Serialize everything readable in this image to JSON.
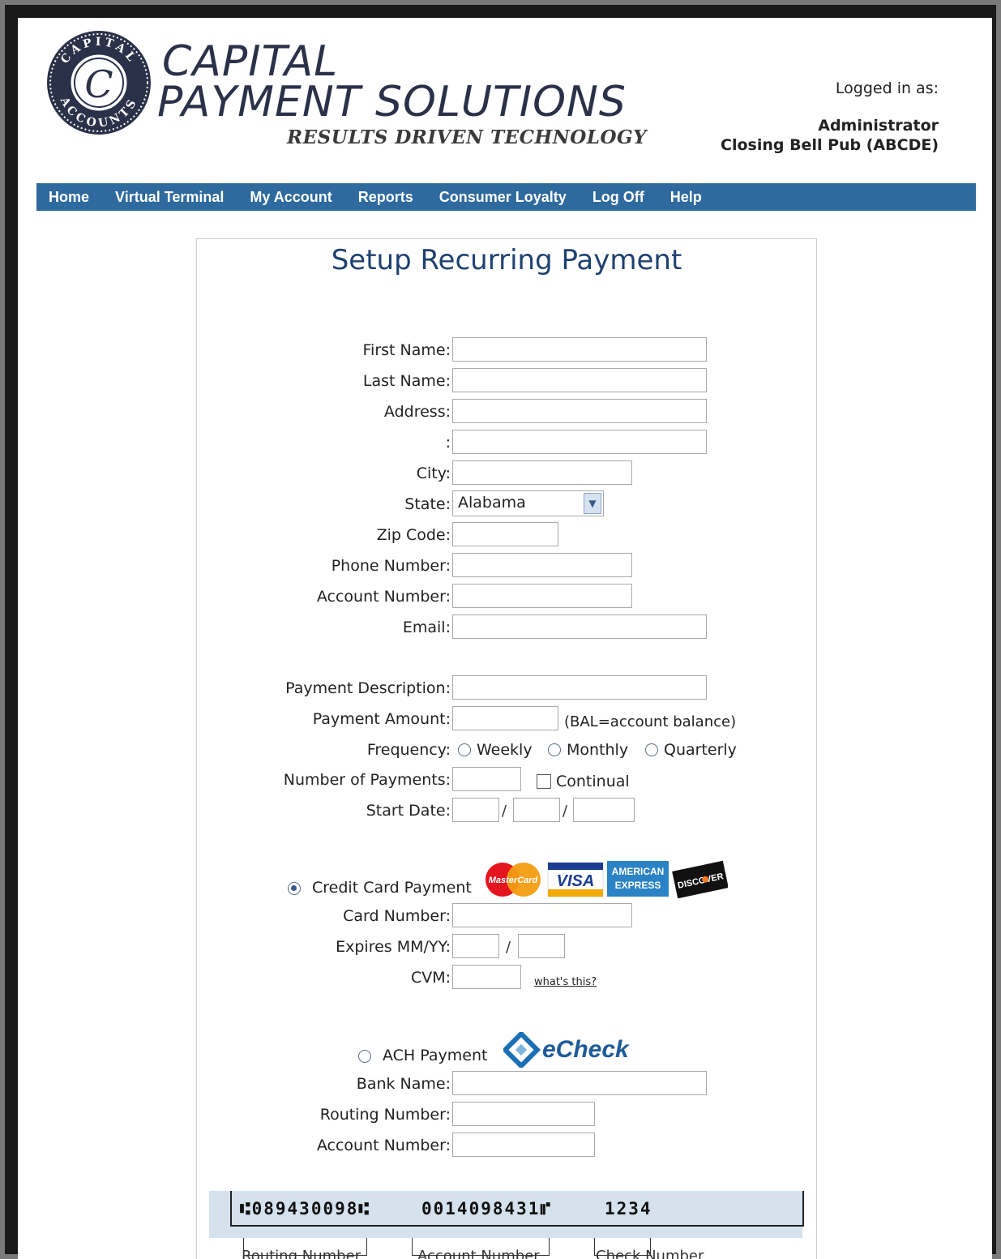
{
  "brand": {
    "line1": "CAPITAL",
    "line2": "PAYMENT SOLUTIONS",
    "tagline": "RESULTS DRIVEN TECHNOLOGY",
    "seal_top": "CAPITAL",
    "seal_bottom": "ACCOUNTS",
    "seal_letter": "C"
  },
  "session": {
    "logged_in_label": "Logged in as:",
    "user": "Administrator",
    "merchant": "Closing Bell Pub (ABCDE)"
  },
  "nav": {
    "items": [
      "Home",
      "Virtual Terminal",
      "My Account",
      "Reports",
      "Consumer Loyalty",
      "Log Off",
      "Help"
    ]
  },
  "form": {
    "title": "Setup Recurring Payment",
    "first_name": "First Name:",
    "last_name": "Last Name:",
    "address": "Address:",
    "address2": ":",
    "city": "City:",
    "state": "State:",
    "state_value": "Alabama",
    "zip": "Zip Code:",
    "phone": "Phone Number:",
    "account_number": "Account Number:",
    "email": "Email:",
    "payment_description": "Payment Description:",
    "payment_amount": "Payment Amount:",
    "amount_note": "(BAL=account balance)",
    "frequency": "Frequency:",
    "freq_weekly": "Weekly",
    "freq_monthly": "Monthly",
    "freq_quarterly": "Quarterly",
    "num_payments": "Number of Payments:",
    "continual": "Continual",
    "start_date": "Start Date:",
    "slash": "/"
  },
  "credit": {
    "option": "Credit Card Payment",
    "card_number": "Card Number:",
    "expires": "Expires MM/YY:",
    "cvm": "CVM:",
    "whats_this": "what's this?",
    "logos": {
      "mastercard": "MasterCard",
      "visa": "VISA",
      "amex_1": "AMERICAN",
      "amex_2": "EXPRESS",
      "discover": "DISCOVER"
    }
  },
  "ach": {
    "option": "ACH Payment",
    "logo": "eCheck",
    "bank_name": "Bank Name:",
    "routing": "Routing Number:",
    "account": "Account Number:"
  },
  "check_sample": {
    "routing_micr": "⑆089430098⑆",
    "account_micr": "0014098431⑈",
    "check_micr": "1234",
    "routing_label": "Routing Number",
    "account_label": "Account Number",
    "check_label": "Check Number"
  },
  "colors": {
    "nav_bg": "#2f6a9e",
    "title": "#1f4170",
    "brand": "#2b3148"
  }
}
